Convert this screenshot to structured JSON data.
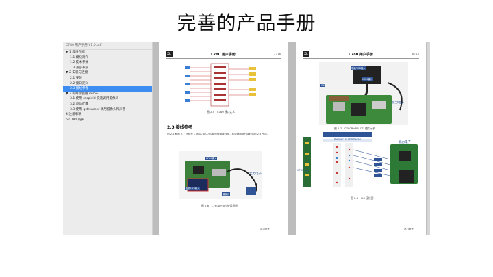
{
  "slide": {
    "title": "完善的产品手册"
  },
  "viewer": {
    "file_name": "C780 用户手册 V1.0.pdf",
    "outline": [
      {
        "label": "▼ 1 模块介绍",
        "level": 1,
        "selected": false
      },
      {
        "label": "1.1 模块简介",
        "level": 2,
        "selected": false
      },
      {
        "label": "1.2 技术参数",
        "level": 2,
        "selected": false
      },
      {
        "label": "1.3 兼容系统",
        "level": 2,
        "selected": false
      },
      {
        "label": "▼ 2 安装与连接",
        "level": 1,
        "selected": false
      },
      {
        "label": "2.1 安装",
        "level": 2,
        "selected": false
      },
      {
        "label": "2.2 接口定义",
        "level": 2,
        "selected": false
      },
      {
        "label": "2.3 接线参考",
        "level": 2,
        "selected": true
      },
      {
        "label": "▼ 3 树莓派使用 demo",
        "level": 1,
        "selected": false
      },
      {
        "label": "3.1 使用 raspivid 快速调用摄像头",
        "level": 2,
        "selected": false
      },
      {
        "label": "3.2 驱动配置",
        "level": 2,
        "selected": false
      },
      {
        "label": "3.3 使用 gstreamer 调用摄像头和声音",
        "level": 2,
        "selected": false
      },
      {
        "label": "4 注意事项",
        "level": 1,
        "selected": false
      },
      {
        "label": "5 C780 购买",
        "level": 1,
        "selected": false
      }
    ]
  },
  "page1": {
    "header_title": "C780 用户手册",
    "page_num": "7 / 16",
    "logo": "ZL",
    "fig1_caption": "图 2.5　C780 接口定义",
    "section_heading": "2.3 接线参考",
    "para": "图 2.6 和图 2.7 分别为 C780A 和 C780B 的使用接线图，其中黄圈部分接线如图 2.8 所示。",
    "fig2_caption": "图 2.6　C780A+RPI 使用示例",
    "watermark": "北力电子",
    "footer": "北力电子",
    "labels": {
      "hdmi": "HDMI输入",
      "pwr": "电源/USB输入",
      "cam": "摄像头"
    }
  },
  "page2": {
    "header_title": "C780 用户手册",
    "page_num": "8 / 16",
    "logo": "ZL",
    "fig1_caption": "图 2.7　C780B+RPI CSI 使用示例",
    "fig2_caption": "图 2.8　I2S 接线图",
    "table_title": "Raspberry Pi GPIO Header",
    "gpio_label": "GPIO pins",
    "watermark": "北力电子",
    "footer": "北力电子",
    "labels": {
      "usb": "电源/USB输入",
      "hdmi": "HDMI输入",
      "csi": "CSI"
    }
  },
  "colors": {
    "accent": "#3d8cf2",
    "label_blue": "#2f5597"
  }
}
